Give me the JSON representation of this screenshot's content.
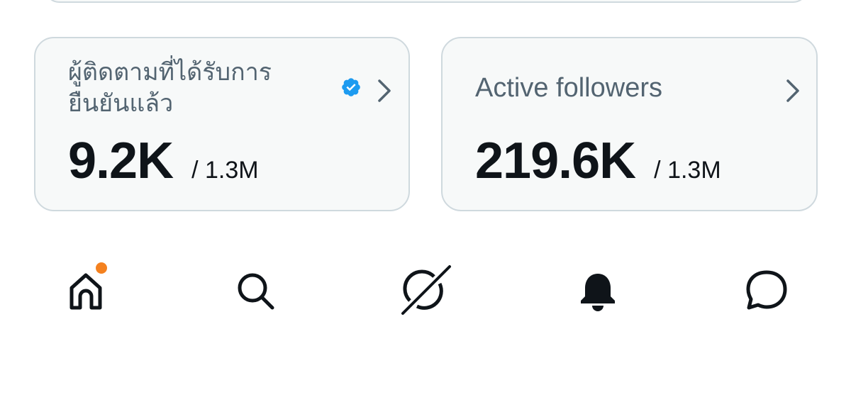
{
  "cards": [
    {
      "title": "ผู้ติดตามที่ได้รับการยืนยันแล้ว",
      "verified_icon": "verified-badge-icon",
      "value": "9.2K",
      "total": "/ 1.3M"
    },
    {
      "title": "Active followers",
      "value": "219.6K",
      "total": "/ 1.3M"
    }
  ],
  "bottom_nav": {
    "items": [
      {
        "icon": "home-icon",
        "has_notification_dot": true
      },
      {
        "icon": "search-icon"
      },
      {
        "icon": "grok-icon"
      },
      {
        "icon": "bell-icon"
      },
      {
        "icon": "messages-icon"
      }
    ]
  },
  "colors": {
    "card_bg": "#f7f9f9",
    "card_border": "#cfd9de",
    "secondary_text": "#536471",
    "primary_text": "#0f1419",
    "verified_blue": "#1d9bf0",
    "notification_dot": "#f4811f"
  }
}
